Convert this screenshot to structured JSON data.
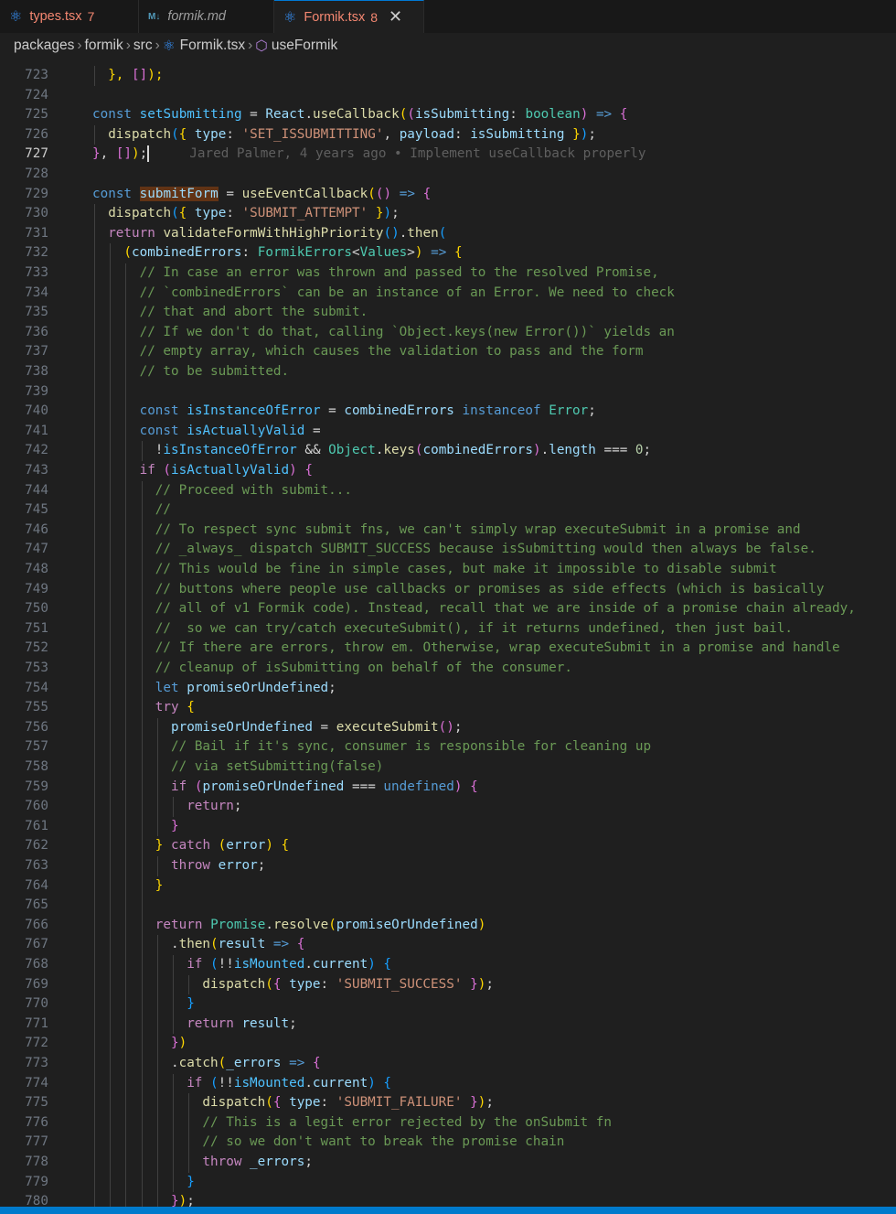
{
  "tabs": [
    {
      "label": "types.tsx",
      "icon": "react-icon",
      "problems": "7",
      "active": false,
      "style": "err"
    },
    {
      "label": "formik.md",
      "icon": "markdown-icon",
      "problems": "",
      "active": false,
      "style": "italic"
    },
    {
      "label": "Formik.tsx",
      "icon": "react-icon",
      "problems": "8",
      "active": true,
      "style": "err"
    }
  ],
  "breadcrumbs": [
    "packages",
    "formik",
    "src",
    "Formik.tsx",
    "useFormik"
  ],
  "cursor_line": 727,
  "blame": "Jared Palmer, 4 years ago • Implement useCallback properly",
  "colors": {
    "statusbar": "#007acc",
    "editor_bg": "#1f1f1f",
    "highlight": "#613315"
  },
  "lines": [
    {
      "n": 723,
      "indent": 1,
      "segs": [
        [
          "},",
          "p1"
        ],
        [
          " ",
          "p"
        ],
        [
          "[]",
          "p2"
        ],
        [
          ");",
          "p1"
        ]
      ]
    },
    {
      "n": 724,
      "indent": 0,
      "segs": []
    },
    {
      "n": 725,
      "indent": 0,
      "segs": [
        [
          "const",
          "kw"
        ],
        [
          " ",
          "p"
        ],
        [
          "setSubmitting",
          "const"
        ],
        [
          " = ",
          "p"
        ],
        [
          "React",
          "var"
        ],
        [
          ".",
          "p"
        ],
        [
          "useCallback",
          "fn"
        ],
        [
          "(",
          "p1"
        ],
        [
          "(",
          "p2"
        ],
        [
          "isSubmitting",
          "var"
        ],
        [
          ": ",
          "p"
        ],
        [
          "boolean",
          "type"
        ],
        [
          ")",
          "p2"
        ],
        [
          " ",
          "p"
        ],
        [
          "=>",
          "kw"
        ],
        [
          " ",
          "p"
        ],
        [
          "{",
          "p2"
        ]
      ]
    },
    {
      "n": 726,
      "indent": 1,
      "segs": [
        [
          "dispatch",
          "fn"
        ],
        [
          "(",
          "p3"
        ],
        [
          "{",
          "p1"
        ],
        [
          " ",
          "p"
        ],
        [
          "type",
          "var"
        ],
        [
          ": ",
          "p"
        ],
        [
          "'SET_ISSUBMITTING'",
          "str"
        ],
        [
          ", ",
          "p"
        ],
        [
          "payload",
          "var"
        ],
        [
          ": ",
          "p"
        ],
        [
          "isSubmitting",
          "var"
        ],
        [
          " ",
          "p"
        ],
        [
          "}",
          "p1"
        ],
        [
          ")",
          "p3"
        ],
        [
          ";",
          "p"
        ]
      ]
    },
    {
      "n": 727,
      "indent": 0,
      "segs": [
        [
          "}",
          "p2"
        ],
        [
          ", ",
          "p"
        ],
        [
          "[]",
          "p2"
        ],
        [
          ")",
          "p1"
        ],
        [
          ";",
          "p"
        ]
      ],
      "current": true
    },
    {
      "n": 728,
      "indent": 0,
      "segs": []
    },
    {
      "n": 729,
      "indent": 0,
      "segs": [
        [
          "const",
          "kw"
        ],
        [
          " ",
          "p"
        ],
        [
          "submitForm",
          "hl"
        ],
        [
          " = ",
          "p"
        ],
        [
          "useEventCallback",
          "fn"
        ],
        [
          "(",
          "p1"
        ],
        [
          "()",
          "p2"
        ],
        [
          " ",
          "p"
        ],
        [
          "=>",
          "kw"
        ],
        [
          " ",
          "p"
        ],
        [
          "{",
          "p2"
        ]
      ]
    },
    {
      "n": 730,
      "indent": 1,
      "segs": [
        [
          "dispatch",
          "fn"
        ],
        [
          "(",
          "p3"
        ],
        [
          "{",
          "p1"
        ],
        [
          " ",
          "p"
        ],
        [
          "type",
          "var"
        ],
        [
          ": ",
          "p"
        ],
        [
          "'SUBMIT_ATTEMPT'",
          "str"
        ],
        [
          " ",
          "p"
        ],
        [
          "}",
          "p1"
        ],
        [
          ")",
          "p3"
        ],
        [
          ";",
          "p"
        ]
      ]
    },
    {
      "n": 731,
      "indent": 1,
      "segs": [
        [
          "return",
          "ctl"
        ],
        [
          " ",
          "p"
        ],
        [
          "validateFormWithHighPriority",
          "fn"
        ],
        [
          "()",
          "p3"
        ],
        [
          ".",
          "p"
        ],
        [
          "then",
          "fn"
        ],
        [
          "(",
          "p3"
        ]
      ]
    },
    {
      "n": 732,
      "indent": 2,
      "segs": [
        [
          "(",
          "p1"
        ],
        [
          "combinedErrors",
          "var"
        ],
        [
          ": ",
          "p"
        ],
        [
          "FormikErrors",
          "type"
        ],
        [
          "<",
          "p"
        ],
        [
          "Values",
          "type"
        ],
        [
          ">",
          "p"
        ],
        [
          ")",
          "p1"
        ],
        [
          " ",
          "p"
        ],
        [
          "=>",
          "kw"
        ],
        [
          " ",
          "p"
        ],
        [
          "{",
          "p1"
        ]
      ]
    },
    {
      "n": 733,
      "indent": 3,
      "segs": [
        [
          "// In case an error was thrown and passed to the resolved Promise,",
          "cmt"
        ]
      ]
    },
    {
      "n": 734,
      "indent": 3,
      "segs": [
        [
          "// `combinedErrors` can be an instance of an Error. We need to check",
          "cmt"
        ]
      ]
    },
    {
      "n": 735,
      "indent": 3,
      "segs": [
        [
          "// that and abort the submit.",
          "cmt"
        ]
      ]
    },
    {
      "n": 736,
      "indent": 3,
      "segs": [
        [
          "// If we don't do that, calling `Object.keys(new Error())` yields an",
          "cmt"
        ]
      ]
    },
    {
      "n": 737,
      "indent": 3,
      "segs": [
        [
          "// empty array, which causes the validation to pass and the form",
          "cmt"
        ]
      ]
    },
    {
      "n": 738,
      "indent": 3,
      "segs": [
        [
          "// to be submitted.",
          "cmt"
        ]
      ]
    },
    {
      "n": 739,
      "indent": 3,
      "segs": []
    },
    {
      "n": 740,
      "indent": 3,
      "segs": [
        [
          "const",
          "kw"
        ],
        [
          " ",
          "p"
        ],
        [
          "isInstanceOfError",
          "const"
        ],
        [
          " = ",
          "p"
        ],
        [
          "combinedErrors",
          "var"
        ],
        [
          " ",
          "p"
        ],
        [
          "instanceof",
          "kw"
        ],
        [
          " ",
          "p"
        ],
        [
          "Error",
          "type"
        ],
        [
          ";",
          "p"
        ]
      ]
    },
    {
      "n": 741,
      "indent": 3,
      "segs": [
        [
          "const",
          "kw"
        ],
        [
          " ",
          "p"
        ],
        [
          "isActuallyValid",
          "const"
        ],
        [
          " =",
          "p"
        ]
      ]
    },
    {
      "n": 742,
      "indent": 4,
      "segs": [
        [
          "!",
          "p"
        ],
        [
          "isInstanceOfError",
          "const"
        ],
        [
          " && ",
          "p"
        ],
        [
          "Object",
          "type"
        ],
        [
          ".",
          "p"
        ],
        [
          "keys",
          "fn"
        ],
        [
          "(",
          "p2"
        ],
        [
          "combinedErrors",
          "var"
        ],
        [
          ")",
          "p2"
        ],
        [
          ".",
          "p"
        ],
        [
          "length",
          "var"
        ],
        [
          " === ",
          "p"
        ],
        [
          "0",
          "num"
        ],
        [
          ";",
          "p"
        ]
      ]
    },
    {
      "n": 743,
      "indent": 3,
      "segs": [
        [
          "if",
          "ctl"
        ],
        [
          " ",
          "p"
        ],
        [
          "(",
          "p2"
        ],
        [
          "isActuallyValid",
          "const"
        ],
        [
          ")",
          "p2"
        ],
        [
          " ",
          "p"
        ],
        [
          "{",
          "p2"
        ]
      ]
    },
    {
      "n": 744,
      "indent": 4,
      "segs": [
        [
          "// Proceed with submit...",
          "cmt"
        ]
      ]
    },
    {
      "n": 745,
      "indent": 4,
      "segs": [
        [
          "//",
          "cmt"
        ]
      ]
    },
    {
      "n": 746,
      "indent": 4,
      "segs": [
        [
          "// To respect sync submit fns, we can't simply wrap executeSubmit in a promise and",
          "cmt"
        ]
      ]
    },
    {
      "n": 747,
      "indent": 4,
      "segs": [
        [
          "// _always_ dispatch SUBMIT_SUCCESS because isSubmitting would then always be false.",
          "cmt"
        ]
      ]
    },
    {
      "n": 748,
      "indent": 4,
      "segs": [
        [
          "// This would be fine in simple cases, but make it impossible to disable submit",
          "cmt"
        ]
      ]
    },
    {
      "n": 749,
      "indent": 4,
      "segs": [
        [
          "// buttons where people use callbacks or promises as side effects (which is basically",
          "cmt"
        ]
      ]
    },
    {
      "n": 750,
      "indent": 4,
      "segs": [
        [
          "// all of v1 Formik code). Instead, recall that we are inside of a promise chain already,",
          "cmt"
        ]
      ]
    },
    {
      "n": 751,
      "indent": 4,
      "segs": [
        [
          "//  so we can try/catch executeSubmit(), if it returns undefined, then just bail.",
          "cmt"
        ]
      ]
    },
    {
      "n": 752,
      "indent": 4,
      "segs": [
        [
          "// If there are errors, throw em. Otherwise, wrap executeSubmit in a promise and handle",
          "cmt"
        ]
      ]
    },
    {
      "n": 753,
      "indent": 4,
      "segs": [
        [
          "// cleanup of isSubmitting on behalf of the consumer.",
          "cmt"
        ]
      ]
    },
    {
      "n": 754,
      "indent": 4,
      "segs": [
        [
          "let",
          "kw"
        ],
        [
          " ",
          "p"
        ],
        [
          "promiseOrUndefined",
          "var"
        ],
        [
          ";",
          "p"
        ]
      ]
    },
    {
      "n": 755,
      "indent": 4,
      "segs": [
        [
          "try",
          "ctl"
        ],
        [
          " ",
          "p"
        ],
        [
          "{",
          "p1"
        ]
      ]
    },
    {
      "n": 756,
      "indent": 5,
      "segs": [
        [
          "promiseOrUndefined",
          "var"
        ],
        [
          " = ",
          "p"
        ],
        [
          "executeSubmit",
          "fn"
        ],
        [
          "()",
          "p2"
        ],
        [
          ";",
          "p"
        ]
      ]
    },
    {
      "n": 757,
      "indent": 5,
      "segs": [
        [
          "// Bail if it's sync, consumer is responsible for cleaning up",
          "cmt"
        ]
      ]
    },
    {
      "n": 758,
      "indent": 5,
      "segs": [
        [
          "// via setSubmitting(false)",
          "cmt"
        ]
      ]
    },
    {
      "n": 759,
      "indent": 5,
      "segs": [
        [
          "if",
          "ctl"
        ],
        [
          " ",
          "p"
        ],
        [
          "(",
          "p2"
        ],
        [
          "promiseOrUndefined",
          "var"
        ],
        [
          " === ",
          "p"
        ],
        [
          "undefined",
          "kw"
        ],
        [
          ")",
          "p2"
        ],
        [
          " ",
          "p"
        ],
        [
          "{",
          "p2"
        ]
      ]
    },
    {
      "n": 760,
      "indent": 6,
      "segs": [
        [
          "return",
          "ctl"
        ],
        [
          ";",
          "p"
        ]
      ]
    },
    {
      "n": 761,
      "indent": 5,
      "segs": [
        [
          "}",
          "p2"
        ]
      ]
    },
    {
      "n": 762,
      "indent": 4,
      "segs": [
        [
          "}",
          "p1"
        ],
        [
          " ",
          "p"
        ],
        [
          "catch",
          "ctl"
        ],
        [
          " ",
          "p"
        ],
        [
          "(",
          "p1"
        ],
        [
          "error",
          "var"
        ],
        [
          ")",
          "p1"
        ],
        [
          " ",
          "p"
        ],
        [
          "{",
          "p1"
        ]
      ]
    },
    {
      "n": 763,
      "indent": 5,
      "segs": [
        [
          "throw",
          "ctl"
        ],
        [
          " ",
          "p"
        ],
        [
          "error",
          "var"
        ],
        [
          ";",
          "p"
        ]
      ]
    },
    {
      "n": 764,
      "indent": 4,
      "segs": [
        [
          "}",
          "p1"
        ]
      ]
    },
    {
      "n": 765,
      "indent": 4,
      "segs": []
    },
    {
      "n": 766,
      "indent": 4,
      "segs": [
        [
          "return",
          "ctl"
        ],
        [
          " ",
          "p"
        ],
        [
          "Promise",
          "type"
        ],
        [
          ".",
          "p"
        ],
        [
          "resolve",
          "fn"
        ],
        [
          "(",
          "p1"
        ],
        [
          "promiseOrUndefined",
          "var"
        ],
        [
          ")",
          "p1"
        ]
      ]
    },
    {
      "n": 767,
      "indent": 5,
      "segs": [
        [
          ".",
          "p"
        ],
        [
          "then",
          "fn"
        ],
        [
          "(",
          "p1"
        ],
        [
          "result",
          "var"
        ],
        [
          " ",
          "p"
        ],
        [
          "=>",
          "kw"
        ],
        [
          " ",
          "p"
        ],
        [
          "{",
          "p2"
        ]
      ]
    },
    {
      "n": 768,
      "indent": 6,
      "segs": [
        [
          "if",
          "ctl"
        ],
        [
          " ",
          "p"
        ],
        [
          "(",
          "p3"
        ],
        [
          "!!",
          "p"
        ],
        [
          "isMounted",
          "const"
        ],
        [
          ".",
          "p"
        ],
        [
          "current",
          "var"
        ],
        [
          ")",
          "p3"
        ],
        [
          " ",
          "p"
        ],
        [
          "{",
          "p3"
        ]
      ]
    },
    {
      "n": 769,
      "indent": 7,
      "segs": [
        [
          "dispatch",
          "fn"
        ],
        [
          "(",
          "p1"
        ],
        [
          "{",
          "p2"
        ],
        [
          " ",
          "p"
        ],
        [
          "type",
          "var"
        ],
        [
          ": ",
          "p"
        ],
        [
          "'SUBMIT_SUCCESS'",
          "str"
        ],
        [
          " ",
          "p"
        ],
        [
          "}",
          "p2"
        ],
        [
          ")",
          "p1"
        ],
        [
          ";",
          "p"
        ]
      ]
    },
    {
      "n": 770,
      "indent": 6,
      "segs": [
        [
          "}",
          "p3"
        ]
      ]
    },
    {
      "n": 771,
      "indent": 6,
      "segs": [
        [
          "return",
          "ctl"
        ],
        [
          " ",
          "p"
        ],
        [
          "result",
          "var"
        ],
        [
          ";",
          "p"
        ]
      ]
    },
    {
      "n": 772,
      "indent": 5,
      "segs": [
        [
          "}",
          "p2"
        ],
        [
          ")",
          "p1"
        ]
      ]
    },
    {
      "n": 773,
      "indent": 5,
      "segs": [
        [
          ".",
          "p"
        ],
        [
          "catch",
          "fn"
        ],
        [
          "(",
          "p1"
        ],
        [
          "_errors",
          "var"
        ],
        [
          " ",
          "p"
        ],
        [
          "=>",
          "kw"
        ],
        [
          " ",
          "p"
        ],
        [
          "{",
          "p2"
        ]
      ]
    },
    {
      "n": 774,
      "indent": 6,
      "segs": [
        [
          "if",
          "ctl"
        ],
        [
          " ",
          "p"
        ],
        [
          "(",
          "p3"
        ],
        [
          "!!",
          "p"
        ],
        [
          "isMounted",
          "const"
        ],
        [
          ".",
          "p"
        ],
        [
          "current",
          "var"
        ],
        [
          ")",
          "p3"
        ],
        [
          " ",
          "p"
        ],
        [
          "{",
          "p3"
        ]
      ]
    },
    {
      "n": 775,
      "indent": 7,
      "segs": [
        [
          "dispatch",
          "fn"
        ],
        [
          "(",
          "p1"
        ],
        [
          "{",
          "p2"
        ],
        [
          " ",
          "p"
        ],
        [
          "type",
          "var"
        ],
        [
          ": ",
          "p"
        ],
        [
          "'SUBMIT_FAILURE'",
          "str"
        ],
        [
          " ",
          "p"
        ],
        [
          "}",
          "p2"
        ],
        [
          ")",
          "p1"
        ],
        [
          ";",
          "p"
        ]
      ]
    },
    {
      "n": 776,
      "indent": 7,
      "segs": [
        [
          "// This is a legit error rejected by the onSubmit fn",
          "cmt"
        ]
      ]
    },
    {
      "n": 777,
      "indent": 7,
      "segs": [
        [
          "// so we don't want to break the promise chain",
          "cmt"
        ]
      ]
    },
    {
      "n": 778,
      "indent": 7,
      "segs": [
        [
          "throw",
          "ctl"
        ],
        [
          " ",
          "p"
        ],
        [
          "_errors",
          "var"
        ],
        [
          ";",
          "p"
        ]
      ]
    },
    {
      "n": 779,
      "indent": 6,
      "segs": [
        [
          "}",
          "p3"
        ]
      ]
    },
    {
      "n": 780,
      "indent": 5,
      "segs": [
        [
          "}",
          "p2"
        ],
        [
          ")",
          "p1"
        ],
        [
          ";",
          "p"
        ]
      ]
    }
  ]
}
